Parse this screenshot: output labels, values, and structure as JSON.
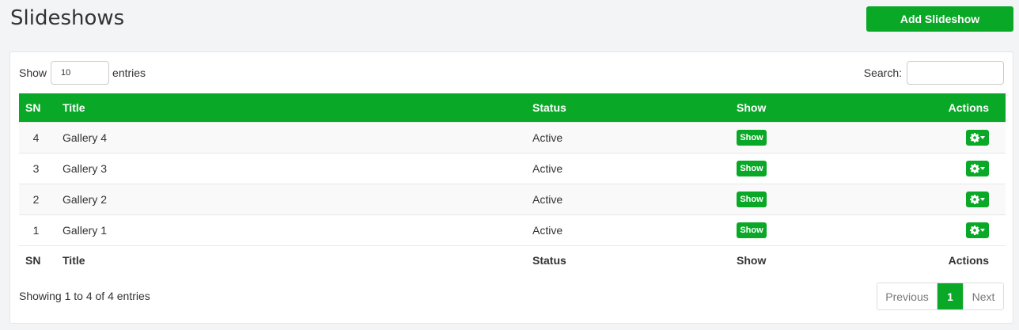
{
  "page": {
    "title": "Slideshows",
    "add_label": "Add Slideshow"
  },
  "length": {
    "prefix": "Show",
    "value": "10",
    "suffix": "entries"
  },
  "search": {
    "label": "Search:",
    "value": ""
  },
  "table": {
    "headers": {
      "sn": "SN",
      "title": "Title",
      "status": "Status",
      "show": "Show",
      "actions": "Actions"
    },
    "rows": [
      {
        "sn": "4",
        "title": "Gallery 4",
        "status": "Active",
        "show_label": "Show"
      },
      {
        "sn": "3",
        "title": "Gallery 3",
        "status": "Active",
        "show_label": "Show"
      },
      {
        "sn": "2",
        "title": "Gallery 2",
        "status": "Active",
        "show_label": "Show"
      },
      {
        "sn": "1",
        "title": "Gallery 1",
        "status": "Active",
        "show_label": "Show"
      }
    ]
  },
  "info": "Showing 1 to 4 of 4 entries",
  "pagination": {
    "previous": "Previous",
    "current": "1",
    "next": "Next"
  },
  "icons": {
    "actions": "gear-icon"
  },
  "colors": {
    "accent": "#0aa827"
  }
}
